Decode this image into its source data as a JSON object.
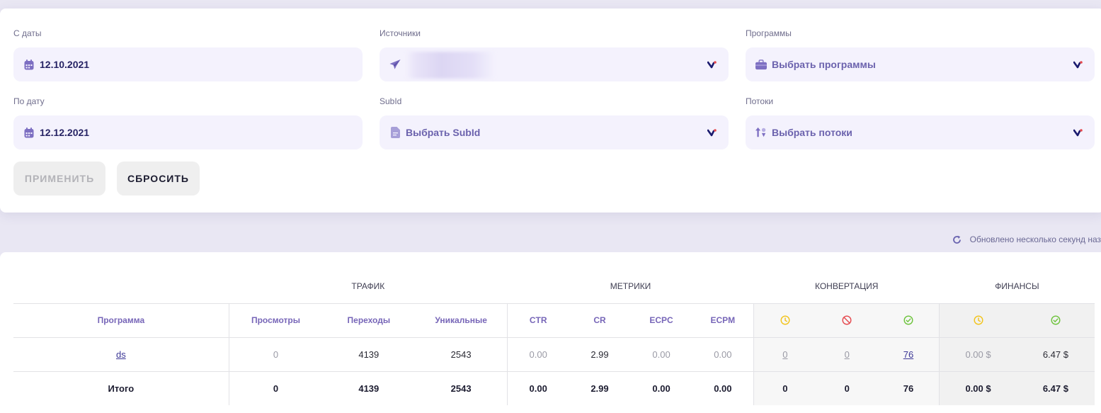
{
  "filters": {
    "date_from": {
      "label": "С даты",
      "value": "12.10.2021",
      "icon": "calendar-icon"
    },
    "date_to": {
      "label": "По дату",
      "value": "12.12.2021",
      "icon": "calendar-icon"
    },
    "sources": {
      "label": "Источники",
      "value": "",
      "icon": "paper-plane-icon"
    },
    "subid": {
      "label": "SubId",
      "value": "Выбрать SubId",
      "icon": "document-icon"
    },
    "programs": {
      "label": "Программы",
      "value": "Выбрать программы",
      "icon": "briefcase-icon"
    },
    "streams": {
      "label": "Потоки",
      "value": "Выбрать потоки",
      "icon": "arrows-shapes-icon"
    }
  },
  "buttons": {
    "apply": "ПРИМЕНИТЬ",
    "reset": "СБРОСИТЬ"
  },
  "updated_text": "Обновлено несколько секунд наз",
  "table": {
    "groups": {
      "traffic": "ТРАФИК",
      "metrics": "МЕТРИКИ",
      "conversion": "КОНВЕРТАЦИЯ",
      "finance": "ФИНАНСЫ"
    },
    "columns": {
      "program": "Программа",
      "views": "Просмотры",
      "clicks": "Переходы",
      "unique": "Уникальные",
      "ctr": "CTR",
      "cr": "CR",
      "ecpc": "ECPC",
      "ecpm": "ECPM"
    },
    "status_icons": {
      "pending": "clock-icon",
      "rejected": "forbidden-icon",
      "approved": "check-circle-icon"
    },
    "status_colors": {
      "pending": "#f2c318",
      "rejected": "#e5484d",
      "approved": "#6cc33a"
    },
    "row": {
      "program": "ds",
      "views": "0",
      "clicks": "4139",
      "unique": "2543",
      "ctr": "0.00",
      "cr": "2.99",
      "ecpc": "0.00",
      "ecpm": "0.00",
      "conv_pending": "0",
      "conv_rejected": "0",
      "conv_approved": "76",
      "fin_pending": "0.00 $",
      "fin_approved": "6.47 $"
    },
    "total": {
      "label": "Итого",
      "views": "0",
      "clicks": "4139",
      "unique": "2543",
      "ctr": "0.00",
      "cr": "2.99",
      "ecpc": "0.00",
      "ecpm": "0.00",
      "conv_pending": "0",
      "conv_rejected": "0",
      "conv_approved": "76",
      "fin_pending": "0.00 $",
      "fin_approved": "6.47 $"
    }
  }
}
